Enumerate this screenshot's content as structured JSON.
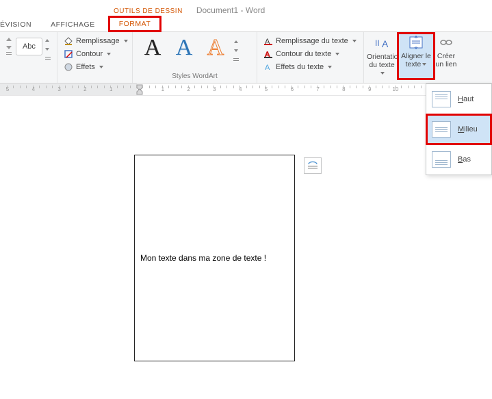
{
  "title": {
    "tool_tab": "OUTILS DE DESSIN",
    "document": "Document1 - Word"
  },
  "tabs": {
    "revision": "ÉVISION",
    "affichage": "AFFICHAGE",
    "format": "FORMAT"
  },
  "ribbon": {
    "abc_label": "Abc",
    "fill": "Remplissage",
    "contour": "Contour",
    "effects": "Effets",
    "text_fill": "Remplissage du texte",
    "text_contour": "Contour du texte",
    "text_effects": "Effets du texte",
    "wordart_group": "Styles WordArt",
    "orientation": "Orientation du texte",
    "align_text": "Aligner le texte",
    "create_link": "Créer un lien",
    "wa_glyph": "A"
  },
  "align_menu": {
    "top": "Haut",
    "middle": "Milieu",
    "bottom": "Bas"
  },
  "ruler": {
    "neg": [
      "5",
      "4",
      "3",
      "2",
      "1"
    ],
    "pos": [
      "1",
      "2",
      "3",
      "4",
      "5",
      "6",
      "7",
      "8",
      "9",
      "10"
    ]
  },
  "document": {
    "textbox_content": "Mon texte dans ma zone de texte !"
  }
}
